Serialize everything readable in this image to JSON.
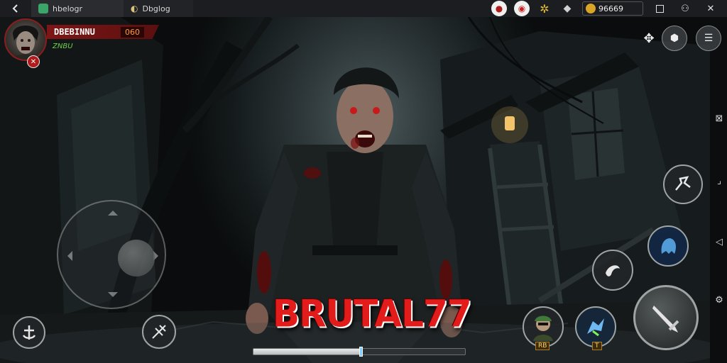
{
  "browser": {
    "tabs": [
      {
        "label": "hbelogr",
        "active": true,
        "fav_color": "#3aa66a"
      },
      {
        "label": "Dbglog",
        "active": false,
        "fav_color": "#d9c27a"
      }
    ],
    "coins": "96669",
    "icons": [
      "back-icon",
      "pin-icon",
      "alert-icon",
      "gear-icon",
      "bell-icon",
      "coin-icon",
      "window-restore-icon",
      "account-icon",
      "close-icon"
    ]
  },
  "player": {
    "name": "DBEBINNU",
    "score": "060",
    "tag": "ZNBU",
    "badge": "✕"
  },
  "hud": {
    "right_edge_icons": [
      "compass-icon",
      "expand-icon",
      "back-triangle-icon",
      "settings-cog-icon"
    ]
  },
  "skills": {
    "slot1_label": "RB",
    "slot2_label": "T"
  },
  "logo_text": "BRUTAL77",
  "progress": {
    "value": 0.51
  },
  "colors": {
    "accent_red": "#e21b1b",
    "hud_red": "#7e1616",
    "tag_green": "#6fd04a"
  }
}
